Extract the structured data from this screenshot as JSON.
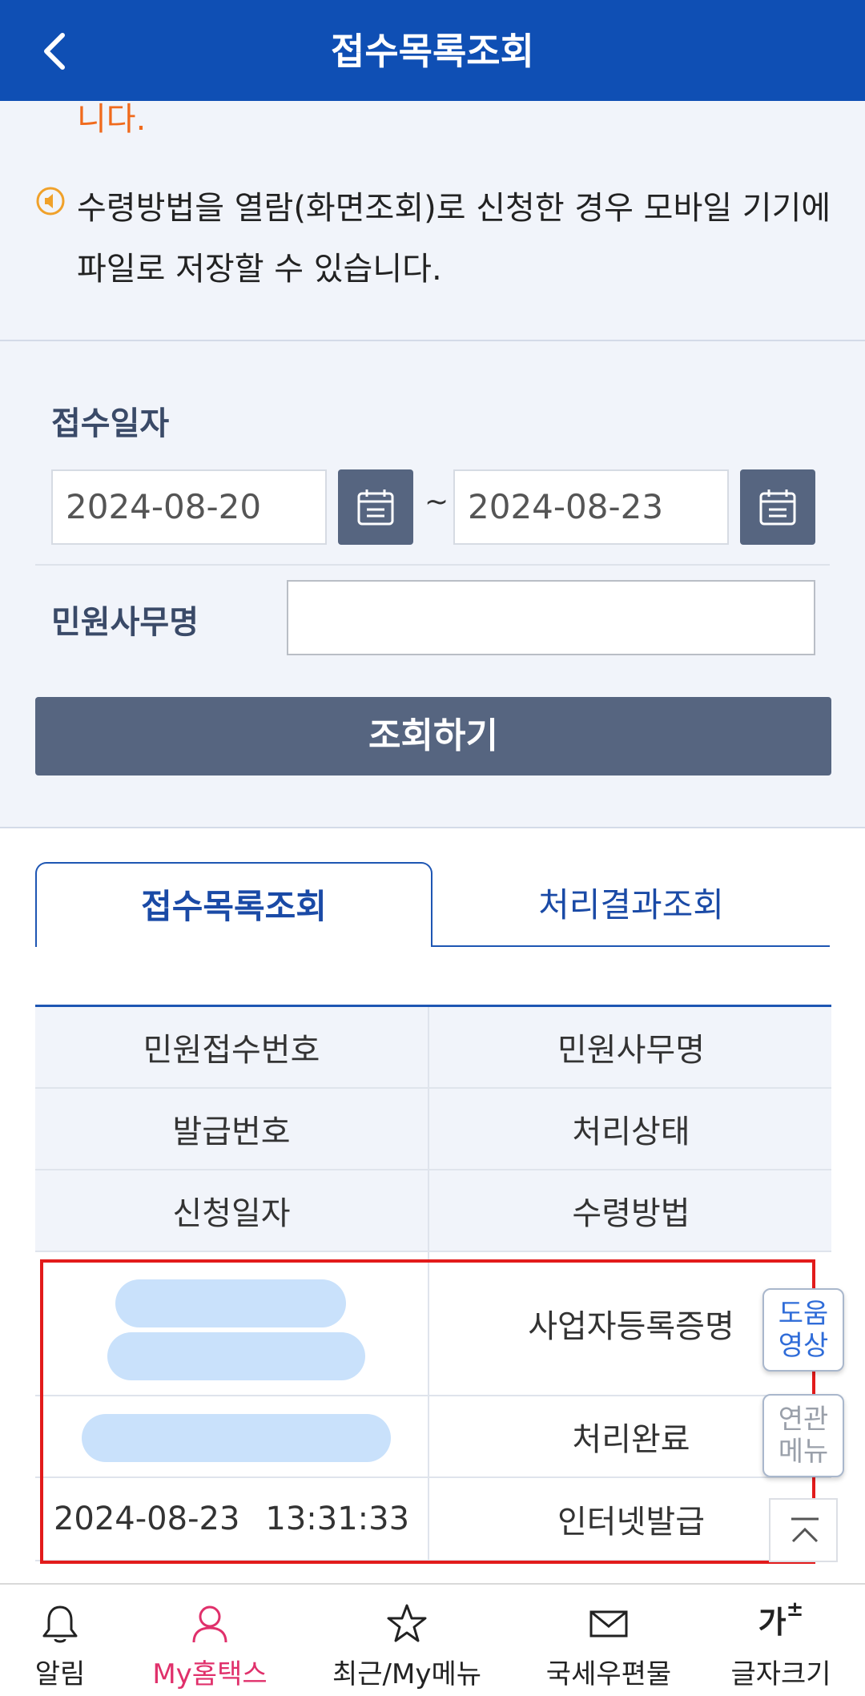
{
  "header": {
    "title": "접수목록조회",
    "back_icon": "chevron-left-icon"
  },
  "notice": {
    "cut_text": "니다.",
    "text": "수령방법을 열람(화면조회)로 신청한 경우 모바일 기기에 파일로 저장할 수 있습니다."
  },
  "form": {
    "date_label": "접수일자",
    "date_from": "2024-08-20",
    "date_to": "2024-08-23",
    "tilde": "~",
    "office_label": "민원사무명",
    "office_value": "",
    "search_button": "조회하기"
  },
  "tabs": [
    {
      "label": "접수목록조회",
      "active": true
    },
    {
      "label": "처리결과조회",
      "active": false
    }
  ],
  "table": {
    "headers": [
      [
        "민원접수번호",
        "민원사무명"
      ],
      [
        "발급번호",
        "처리상태"
      ],
      [
        "신청일자",
        "수령방법"
      ]
    ],
    "row": {
      "office_name": "사업자등록증명",
      "status": "처리완료",
      "date": "2024-08-23",
      "time": "13:31:33",
      "method": "인터넷발급"
    }
  },
  "side_buttons": {
    "help": "도움영상",
    "menu": "연관메뉴"
  },
  "bottom_nav": [
    {
      "label": "알림",
      "icon": "bell-icon",
      "active": false
    },
    {
      "label": "My홈택스",
      "icon": "person-icon",
      "active": true
    },
    {
      "label": "최근/My메뉴",
      "icon": "star-icon",
      "active": false
    },
    {
      "label": "국세우편물",
      "icon": "mail-icon",
      "active": false
    },
    {
      "label": "글자크기",
      "icon": "font-size-icon",
      "active": false
    }
  ],
  "colors": {
    "brand": "#0f4fb4",
    "accent_pink": "#e0306b",
    "highlight_red": "#e21b1b",
    "button_gray": "#566580"
  }
}
